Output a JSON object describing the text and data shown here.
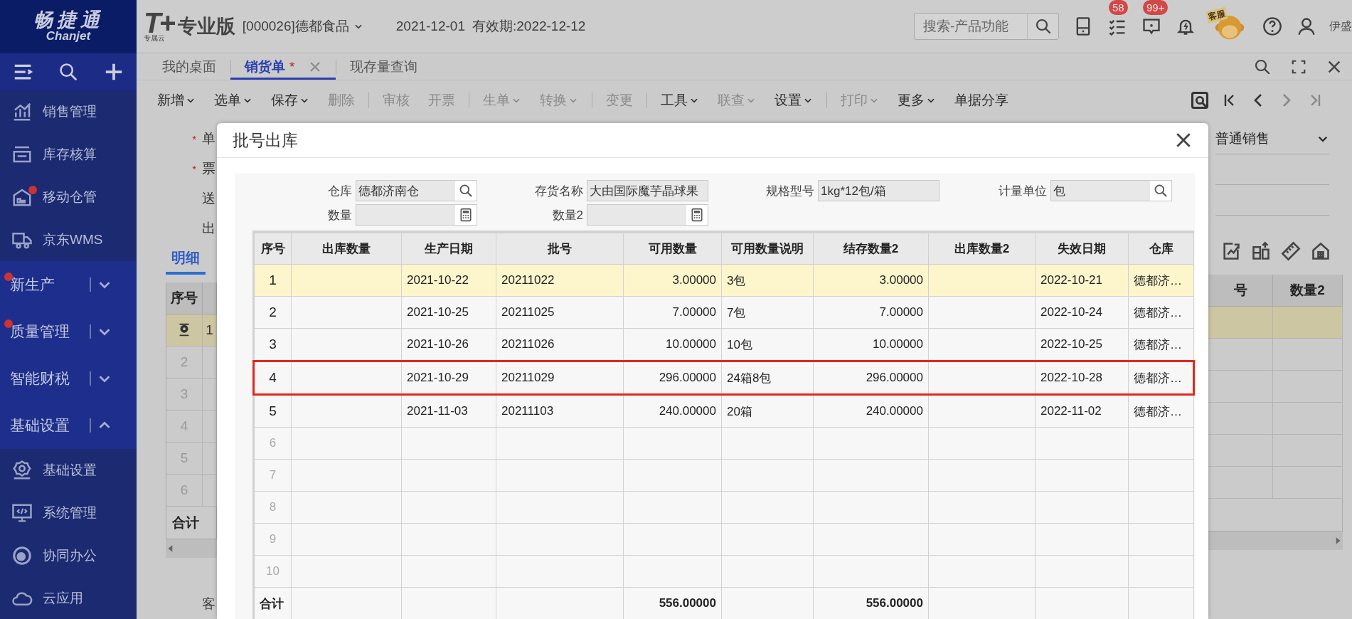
{
  "header": {
    "logo": {
      "title": "畅捷通",
      "subtitle": "Chanjet"
    },
    "product": {
      "mark": "T+",
      "cloud": "专属云",
      "edition": "专业版"
    },
    "company": "[000026]德都食品",
    "date": "2021-12-01",
    "validity": "有效期:2022-12-12",
    "search": {
      "placeholder": "搜索-产品功能"
    },
    "task_badge": "58",
    "alert_badge": "99+",
    "support": "客服",
    "user": "伊盛"
  },
  "sidebar": {
    "items": [
      {
        "kind": "module",
        "label": "销售管理",
        "alert": false
      },
      {
        "kind": "module",
        "label": "库存核算",
        "alert": false
      },
      {
        "kind": "module",
        "label": "移动仓管",
        "alert": true
      },
      {
        "kind": "module",
        "label": "京东WMS",
        "alert": false
      },
      {
        "kind": "group",
        "label": "新生产",
        "alert": true,
        "expanded": false
      },
      {
        "kind": "group",
        "label": "质量管理",
        "alert": true,
        "expanded": false
      },
      {
        "kind": "group",
        "label": "智能财税",
        "alert": false,
        "expanded": false
      },
      {
        "kind": "group",
        "label": "基础设置",
        "alert": false,
        "expanded": true
      },
      {
        "kind": "module",
        "label": "基础设置",
        "alert": false
      },
      {
        "kind": "module",
        "label": "系统管理",
        "alert": false
      },
      {
        "kind": "module",
        "label": "协同办公",
        "alert": false
      },
      {
        "kind": "module",
        "label": "云应用",
        "alert": false
      }
    ]
  },
  "tabs": [
    {
      "label": "我的桌面",
      "selected": false
    },
    {
      "label": "销货单",
      "mark": "*",
      "selected": true
    },
    {
      "label": "现存量查询",
      "selected": false
    }
  ],
  "toolbar": {
    "groups": [
      [
        {
          "label": "新增",
          "dropdown": true,
          "disabled": false
        },
        {
          "label": "选单",
          "dropdown": true,
          "disabled": false
        },
        {
          "label": "保存",
          "dropdown": true,
          "disabled": false
        },
        {
          "label": "删除",
          "dropdown": false,
          "disabled": true
        }
      ],
      [
        {
          "label": "审核",
          "dropdown": false,
          "disabled": true
        },
        {
          "label": "开票",
          "dropdown": false,
          "disabled": true
        }
      ],
      [
        {
          "label": "生单",
          "dropdown": true,
          "disabled": true
        },
        {
          "label": "转换",
          "dropdown": true,
          "disabled": true
        }
      ],
      [
        {
          "label": "变更",
          "dropdown": false,
          "disabled": true
        }
      ],
      [
        {
          "label": "工具",
          "dropdown": true,
          "disabled": false
        },
        {
          "label": "联查",
          "dropdown": true,
          "disabled": true
        },
        {
          "label": "设置",
          "dropdown": true,
          "disabled": false
        }
      ],
      [
        {
          "label": "打印",
          "dropdown": true,
          "disabled": true
        },
        {
          "label": "更多",
          "dropdown": true,
          "disabled": false
        },
        {
          "label": "单据分享",
          "dropdown": false,
          "disabled": false
        }
      ]
    ]
  },
  "form": {
    "fields": [
      {
        "label": "单",
        "marker": "*"
      },
      {
        "label": "票",
        "marker": "*"
      },
      {
        "label": "送"
      },
      {
        "label": "出"
      }
    ],
    "sale_type": "普通销售",
    "detail_tab": "明细",
    "grid": {
      "left_columns": [
        "序号"
      ],
      "right_columns": [
        "号",
        "数量2"
      ],
      "total_label": "合计",
      "rows": [
        {
          "value": "1",
          "selected": true
        },
        {
          "no": "2",
          "selected": false
        },
        {
          "no": "3",
          "selected": false
        },
        {
          "no": "4",
          "selected": false
        },
        {
          "no": "5",
          "selected": false
        },
        {
          "no": "6",
          "selected": false
        }
      ]
    },
    "bottom_label": "客"
  },
  "dialog": {
    "title": "批号出库",
    "filters": [
      {
        "label": "仓库",
        "value": "德都济南仓",
        "kind": "lookup"
      },
      {
        "label": "存货名称",
        "value": "大由国际魔芋晶球果",
        "kind": "text"
      },
      {
        "label": "规格型号",
        "value": "1kg*12包/箱",
        "kind": "text"
      },
      {
        "label": "计量单位",
        "value": "包",
        "kind": "lookup"
      },
      {
        "label": "数量",
        "kind": "calculator"
      },
      {
        "label": "数量2",
        "kind": "calculator"
      }
    ],
    "table": {
      "columns": [
        "序号",
        "出库数量",
        "生产日期",
        "批号",
        "可用数量",
        "可用数量说明",
        "结存数量2",
        "出库数量2",
        "失效日期",
        "仓库"
      ],
      "rows": [
        {
          "no": "1",
          "prod_date": "2021-10-22",
          "batch": "20211022",
          "available": "3.00000",
          "available_note": "3包",
          "stock2": "3.00000",
          "expiry": "2022-10-21",
          "warehouse": "德都济…",
          "selected": true,
          "marked": false
        },
        {
          "no": "2",
          "prod_date": "2021-10-25",
          "batch": "20211025",
          "available": "7.00000",
          "available_note": "7包",
          "stock2": "7.00000",
          "expiry": "2022-10-24",
          "warehouse": "德都济…",
          "selected": false,
          "marked": false
        },
        {
          "no": "3",
          "prod_date": "2021-10-26",
          "batch": "20211026",
          "available": "10.00000",
          "available_note": "10包",
          "stock2": "10.00000",
          "expiry": "2022-10-25",
          "warehouse": "德都济…",
          "selected": false,
          "marked": false
        },
        {
          "no": "4",
          "prod_date": "2021-10-29",
          "batch": "20211029",
          "available": "296.00000",
          "available_note": "24箱8包",
          "stock2": "296.00000",
          "expiry": "2022-10-28",
          "warehouse": "德都济…",
          "selected": false,
          "marked": true
        },
        {
          "no": "5",
          "prod_date": "2021-11-03",
          "batch": "20211103",
          "available": "240.00000",
          "available_note": "20箱",
          "stock2": "240.00000",
          "expiry": "2022-11-02",
          "warehouse": "德都济…",
          "selected": false,
          "marked": false
        },
        {
          "no": "6",
          "selected": false,
          "marked": false
        },
        {
          "no": "7",
          "selected": false,
          "marked": false
        },
        {
          "no": "8",
          "selected": false,
          "marked": false
        },
        {
          "no": "9",
          "selected": false,
          "marked": false
        },
        {
          "no": "10",
          "selected": false,
          "marked": false
        }
      ],
      "total": {
        "label": "合计",
        "available": "556.00000",
        "stock2": "556.00000"
      }
    }
  }
}
